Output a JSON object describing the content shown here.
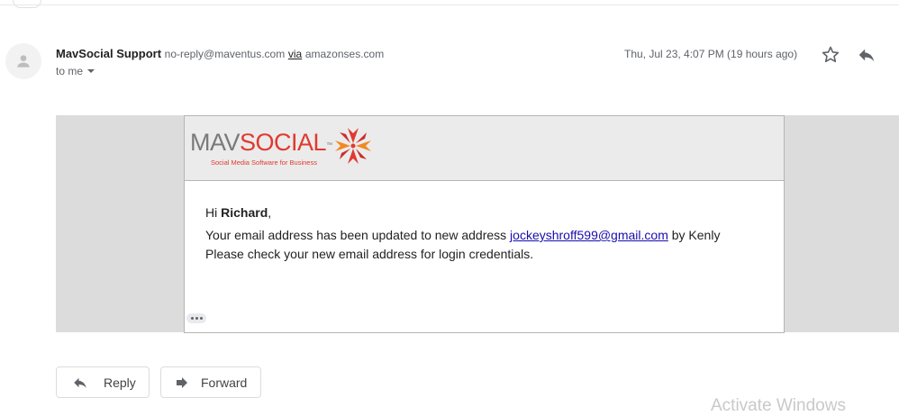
{
  "email": {
    "sender_name": "MavSocial Support",
    "sender_email": "no-reply@maventus.com",
    "via_label": "via",
    "via_domain": "amazonses.com",
    "to_label": "to me",
    "date": "Thu, Jul 23, 4:07 PM (19 hours ago)"
  },
  "message": {
    "logo_mav": "MAV",
    "logo_social": "SOCIAL",
    "logo_tm": "™",
    "logo_tagline": "Social Media Software for Business",
    "greeting_prefix": "Hi ",
    "greeting_name": "Richard",
    "greeting_suffix": ",",
    "line1_prefix": "Your email address has been updated to new address ",
    "line1_link": "jockeyshroff599@gmail.com",
    "line1_suffix": " by Kenly",
    "line2": "Please check your new email address for login credentials."
  },
  "actions": {
    "reply_label": "Reply",
    "forward_label": "Forward"
  },
  "watermark": "Activate Windows",
  "colors": {
    "brand_red": "#e03a2f",
    "brand_gray": "#7a7a7a",
    "link": "#1a0dab"
  },
  "icons": [
    "person-icon",
    "chevron-down-icon",
    "star-icon",
    "reply-icon",
    "forward-icon",
    "ellipsis-icon",
    "logo-x-icon"
  ]
}
